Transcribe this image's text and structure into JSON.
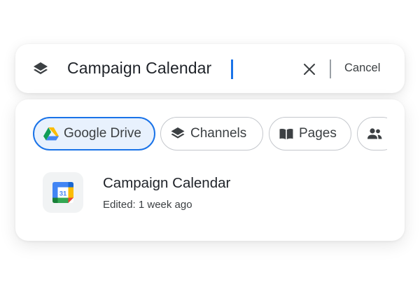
{
  "search": {
    "value": "Campaign Calendar",
    "clear_icon": "close-icon",
    "leading_icon": "layers-icon",
    "cancel_label": "Cancel",
    "caret_color": "#1a73e8"
  },
  "filters": [
    {
      "label": "Google Drive",
      "icon": "google-drive-icon",
      "active": true
    },
    {
      "label": "Channels",
      "icon": "layers-icon",
      "active": false
    },
    {
      "label": "Pages",
      "icon": "book-icon",
      "active": false
    },
    {
      "label": "",
      "icon": "people-icon",
      "active": false
    }
  ],
  "results": [
    {
      "title": "Campaign Calendar",
      "meta": "Edited: 1 week ago",
      "icon": "google-calendar-icon",
      "icon_text": "31"
    }
  ],
  "colors": {
    "accent": "#1a73e8",
    "active_chip_bg": "#e8f1fd",
    "text_primary": "#1f2329",
    "text_secondary": "#3c4043"
  }
}
